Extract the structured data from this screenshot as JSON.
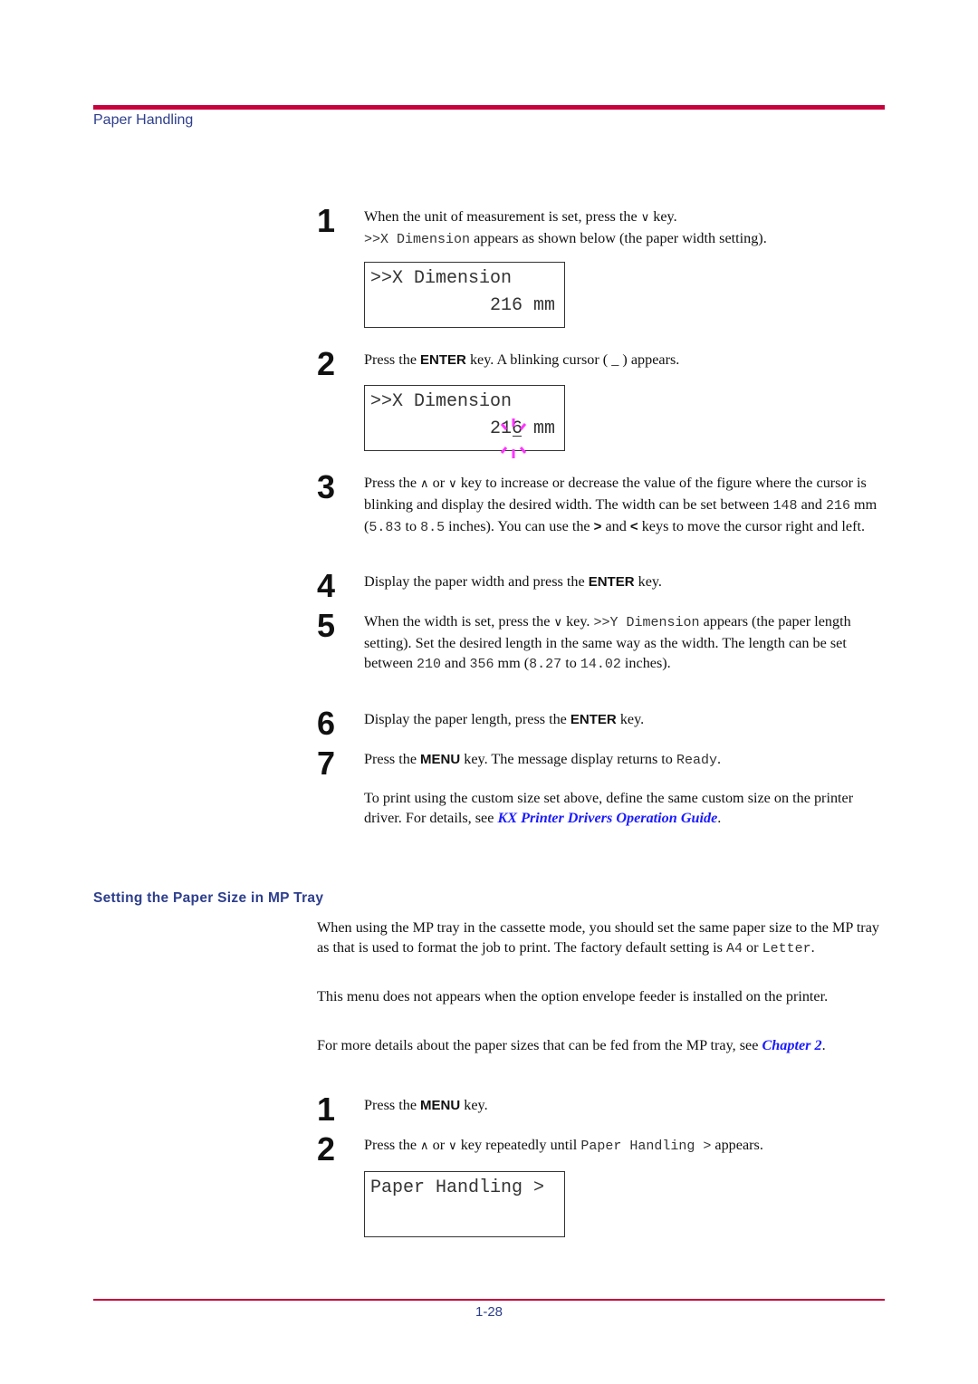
{
  "header": {
    "title": "Paper Handling",
    "accent_color": "#c8003c",
    "title_color": "#2d3e8c"
  },
  "steps_a": [
    {
      "num": "1",
      "t1": "When the unit of measurement is set, press the ",
      "t2": " key.",
      "mono1": ">>X Dimension",
      "t3": " appears as shown below (the paper width setting)."
    },
    {
      "num": "2",
      "t1": "Press the ",
      "key": "ENTER",
      "t2": " key. A blinking cursor ( _ ) appears."
    },
    {
      "num": "3",
      "t1": "Press the ",
      "t2": " or ",
      "t3": " key to increase or decrease the value of the figure where the cursor is blinking and display the desired width. The width can be set between ",
      "m1": "148",
      "t4": " and ",
      "m2": "216",
      "t5": " mm (",
      "m3": "5.83",
      "t6": " to ",
      "m4": "8.5",
      "t7": " inches). You can use the ",
      "k1": ">",
      "t8": " and ",
      "k2": "<",
      "t9": " keys to move the cursor right and left."
    },
    {
      "num": "4",
      "t1": "Display the paper width and press the ",
      "key": "ENTER",
      "t2": " key."
    },
    {
      "num": "5",
      "t1": "When the width is set, press the ",
      "t2": " key. ",
      "mono1": ">>Y Dimension",
      "t3": " appears (the paper length setting). Set the desired length in the same way as the width. The length can be set between ",
      "m1": "210",
      "t4": " and ",
      "m2": "356",
      "t5": " mm (",
      "m3": "8.27",
      "t6": " to ",
      "m4": "14.02",
      "t7": " inches)."
    },
    {
      "num": "6",
      "t1": "Display the paper length, press the ",
      "key": "ENTER",
      "t2": " key."
    },
    {
      "num": "7",
      "t1": "Press the ",
      "key": "MENU",
      "t2": " key. The message display returns to ",
      "mono1": "Ready",
      "t3": "."
    }
  ],
  "lcd1": {
    "line1": ">>X Dimension",
    "value": "216",
    "unit": " mm"
  },
  "lcd2": {
    "line1": ">>X Dimension",
    "value_pre": "21",
    "cursor_digit": "6",
    "unit": " mm"
  },
  "custom_note": {
    "t1": "To print using the custom size set above, define the same custom size on the printer driver. For details, see ",
    "link": "KX Printer Drivers Operation Guide",
    "t2": "."
  },
  "section": {
    "heading": "Setting the Paper Size in MP Tray",
    "p1": {
      "t1": "When using the MP tray in the cassette mode, you should set the same paper size to the MP tray as that is used to format the job to print. The factory default setting is ",
      "m1": "A4",
      "t2": " or ",
      "m2": "Letter",
      "t3": "."
    },
    "p2": "This menu does not appears when the option envelope feeder is installed on the printer.",
    "p3": {
      "t1": "For more details about the paper sizes that can be fed from the MP tray, see ",
      "link": "Chapter 2",
      "t2": "."
    }
  },
  "steps_b": [
    {
      "num": "1",
      "t1": "Press the ",
      "key": "MENU",
      "t2": " key."
    },
    {
      "num": "2",
      "t1": "Press the ",
      "t2": " or ",
      "t3": " key repeatedly until ",
      "mono1": "Paper Handling >",
      "t4": " appears."
    }
  ],
  "lcd3": {
    "line1": "Paper Handling >"
  },
  "icons": {
    "up": "∧",
    "down": "∨"
  },
  "footer": {
    "page_number": "1-28"
  }
}
